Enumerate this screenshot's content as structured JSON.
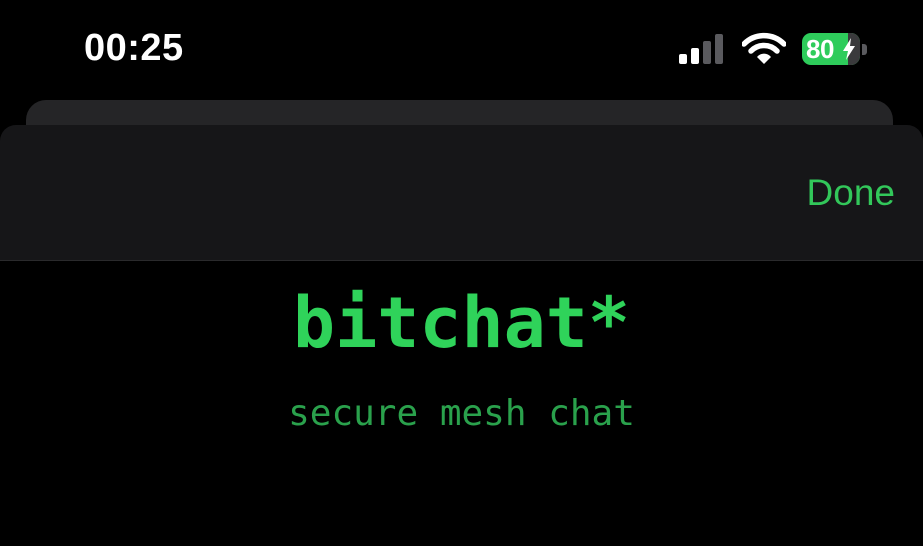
{
  "status_bar": {
    "time": "00:25",
    "battery_level": "80",
    "icons": [
      "cellular-signal-icon",
      "wifi-icon",
      "battery-charging-icon"
    ]
  },
  "nav": {
    "done_label": "Done"
  },
  "main": {
    "title": "bitchat*",
    "subtitle": "secure mesh chat"
  },
  "colors": {
    "accent": "#32c75a",
    "background": "#000000",
    "nav_background": "#161618",
    "battery": "#2ecc5b"
  }
}
